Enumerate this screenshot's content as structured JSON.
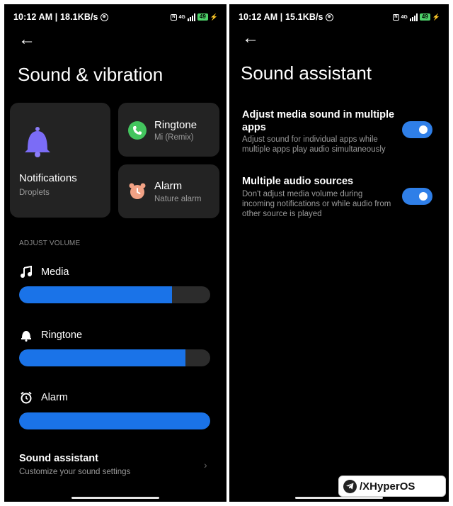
{
  "left": {
    "status": {
      "time": "10:12 AM | 18.1KB/s",
      "network": "4G",
      "battery": "49"
    },
    "title": "Sound & vibration",
    "cards": {
      "notifications": {
        "title": "Notifications",
        "subtitle": "Droplets"
      },
      "ringtone": {
        "title": "Ringtone",
        "subtitle": "Mi (Remix)"
      },
      "alarm": {
        "title": "Alarm",
        "subtitle": "Nature alarm"
      }
    },
    "adjust_volume_label": "ADJUST VOLUME",
    "volumes": [
      {
        "label": "Media",
        "icon": "music-note-icon",
        "level": 0.8
      },
      {
        "label": "Ringtone",
        "icon": "bell-icon",
        "level": 0.87
      },
      {
        "label": "Alarm",
        "icon": "alarm-clock-icon",
        "level": 1.0
      }
    ],
    "sound_assistant": {
      "title": "Sound assistant",
      "subtitle": "Customize your sound settings"
    }
  },
  "right": {
    "status": {
      "time": "10:12 AM | 15.1KB/s",
      "network": "4G",
      "battery": "49"
    },
    "title": "Sound assistant",
    "settings": [
      {
        "title": "Adjust media sound in multiple apps",
        "subtitle": "Adjust sound for individual apps while multiple apps play audio simultaneously",
        "enabled": true
      },
      {
        "title": "Multiple audio sources",
        "subtitle": "Don't adjust media volume during incoming notifications or while audio from other source is played",
        "enabled": true
      }
    ]
  },
  "watermark": "/XHyperOS",
  "colors": {
    "accent": "#1a73e8",
    "toggle": "#2f7fe8",
    "card": "#232323",
    "bell": "#7b6cf6",
    "phone_green": "#43c55e",
    "alarm_peach": "#f2a285"
  }
}
